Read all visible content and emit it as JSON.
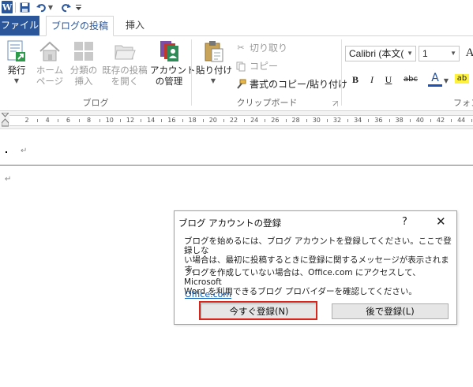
{
  "quick_access": {
    "app_logo": "W",
    "save_icon": "save-icon",
    "undo_icon": "undo-icon",
    "redo_icon": "redo-icon"
  },
  "tabs": [
    {
      "label": "ファイル"
    },
    {
      "label": "ブログの投稿"
    },
    {
      "label": "挿入"
    }
  ],
  "ribbon": {
    "blog_group": {
      "label": "ブログ",
      "publish": {
        "line1": "発行",
        "line2": ""
      },
      "home_page": {
        "line1": "ホーム",
        "line2": "ページ"
      },
      "insert_category": {
        "line1": "分類の",
        "line2": "挿入"
      },
      "open_existing": {
        "line1": "既存の投稿",
        "line2": "を開く"
      },
      "manage_accounts": {
        "line1": "アカウント",
        "line2": "の管理"
      }
    },
    "clipboard_group": {
      "label": "クリップボード",
      "paste": "貼り付け",
      "cut": "切り取り",
      "copy": "コピー",
      "format_painter": "書式のコピー/貼り付け"
    },
    "font_group": {
      "label": "フォン",
      "font_name": "Calibri (本文(",
      "font_size": "1",
      "bold": "B",
      "italic": "I",
      "underline": "U",
      "strikethrough": "abc",
      "font_color": "A",
      "highlight": "ab"
    }
  },
  "ruler": {
    "numbers": [
      "2",
      "4",
      "6",
      "8",
      "10",
      "12",
      "14",
      "16",
      "18",
      "20",
      "22",
      "24",
      "26",
      "28",
      "30",
      "32",
      "34",
      "36",
      "38",
      "40",
      "42",
      "44"
    ]
  },
  "document": {
    "paragraph_mark": "↵"
  },
  "dialog": {
    "title": "ブログ アカウントの登録",
    "help": "?",
    "close": "✕",
    "para1_line1": "ブログを始めるには、ブログ アカウントを登録してください。ここで登録しな",
    "para1_line2": "い場合は、最初に投稿するときに登録に関するメッセージが表示されま",
    "para1_line3": "す。",
    "para2_line1": "ブログを作成していない場合は、Office.com にアクセスして、Microsoft",
    "para2_line2": "Word を利用できるブログ プロバイダーを確認してください。",
    "link": "Office.com",
    "register_now": "今すぐ登録(N)",
    "register_later": "後で登録(L)"
  },
  "colors": {
    "accent": "#2b579a",
    "highlight_border": "#d9261c",
    "link": "#0b5ab3"
  }
}
